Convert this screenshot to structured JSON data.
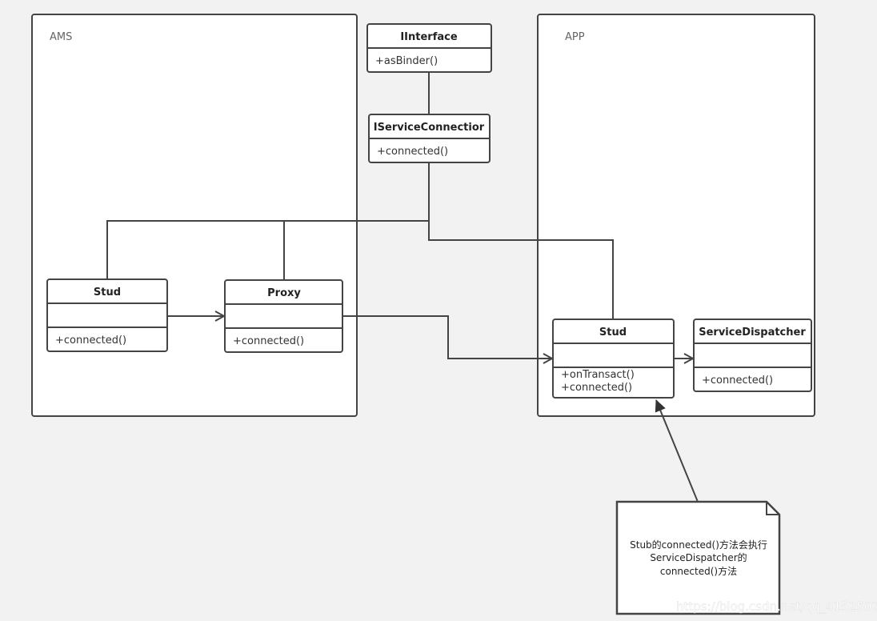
{
  "containers": {
    "ams": "AMS",
    "app": "APP"
  },
  "classes": {
    "iinterface": {
      "name": "IInterface",
      "methods": [
        "+asBinder()"
      ]
    },
    "iserviceconnection": {
      "name": "IServiceConnectior",
      "methods": [
        "+connected()"
      ]
    },
    "ams_stud": {
      "name": "Stud",
      "methods": [
        "+connected()"
      ]
    },
    "proxy": {
      "name": "Proxy",
      "methods": [
        "+connected()"
      ]
    },
    "app_stud": {
      "name": "Stud",
      "methods": [
        "+onTransact()",
        "+connected()"
      ]
    },
    "service_dispatcher": {
      "name": "ServiceDispatcher",
      "methods": [
        "+connected()"
      ]
    }
  },
  "note": {
    "lines": [
      "Stub的connected()方法会执行",
      "ServiceDispatcher的",
      "connected()方法"
    ]
  },
  "watermark": "https://blog.csdn.net/qq_41525021",
  "colors": {
    "background": "#f2f2f2",
    "stroke": "#444444",
    "fill": "#ffffff"
  }
}
